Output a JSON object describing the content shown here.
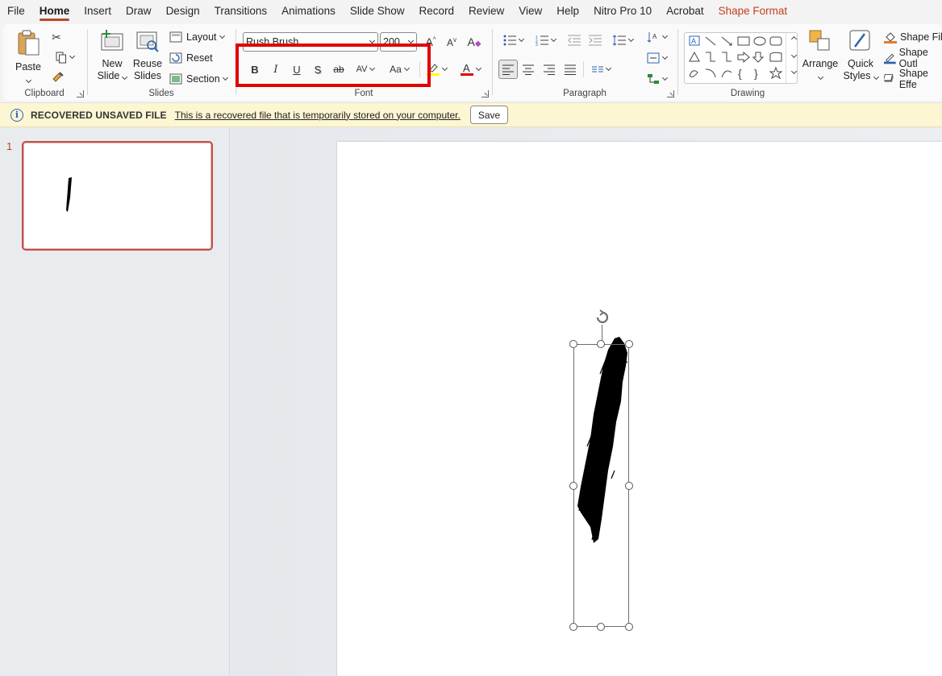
{
  "menu": {
    "tabs": [
      "File",
      "Home",
      "Insert",
      "Draw",
      "Design",
      "Transitions",
      "Animations",
      "Slide Show",
      "Record",
      "Review",
      "View",
      "Help",
      "Nitro Pro 10",
      "Acrobat",
      "Shape Format"
    ],
    "active": "Home",
    "accent": "Shape Format"
  },
  "ribbon": {
    "clipboard": {
      "paste": "Paste",
      "label": "Clipboard"
    },
    "slides": {
      "new_slide_1": "New",
      "new_slide_2": "Slide",
      "reuse_1": "Reuse",
      "reuse_2": "Slides",
      "layout": "Layout",
      "reset": "Reset",
      "section": "Section",
      "label": "Slides"
    },
    "font": {
      "font_name": "Rush Brush",
      "font_size": "200",
      "label": "Font",
      "bold": "B",
      "italic": "I",
      "underline": "U",
      "shadow": "S",
      "strike": "ab",
      "case": "Aa"
    },
    "paragraph": {
      "label": "Paragraph"
    },
    "drawing": {
      "arrange": "Arrange",
      "quick_styles_1": "Quick",
      "quick_styles_2": "Styles",
      "shape_fill": "Shape Fill",
      "shape_outline": "Shape Outl",
      "shape_effects": "Shape Effe",
      "label": "Drawing"
    }
  },
  "infobar": {
    "title": "RECOVERED UNSAVED FILE",
    "message": "This is a recovered file that is temporarily stored on your computer.",
    "save": "Save"
  },
  "thumbnails": {
    "slide_number": "1"
  },
  "colors": {
    "accent": "#c43e1c",
    "highlight": "#e00000",
    "infobar": "#fdf6d3"
  }
}
